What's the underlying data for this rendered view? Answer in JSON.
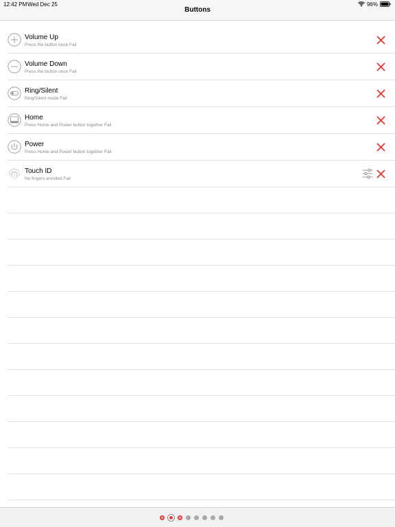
{
  "status_bar": {
    "time": "12:42 PM",
    "date": "Wed Dec 25",
    "battery": "96%"
  },
  "nav": {
    "title": "Buttons"
  },
  "items": [
    {
      "title": "Volume Up",
      "subtitle": "Press the button once Fail",
      "icon": "plus-circle-icon",
      "status": "fail"
    },
    {
      "title": "Volume Down",
      "subtitle": "Press the button once Fail",
      "icon": "minus-circle-icon",
      "status": "fail"
    },
    {
      "title": "Ring/Silent",
      "subtitle": "Ring/Silent mode Fail",
      "icon": "toggle-switch-icon",
      "status": "fail"
    },
    {
      "title": "Home",
      "subtitle": "Press Home and Power button together Fail",
      "icon": "home-button-icon",
      "status": "fail"
    },
    {
      "title": "Power",
      "subtitle": "Press Home and Power button together Fail",
      "icon": "power-icon",
      "status": "fail"
    },
    {
      "title": "Touch ID",
      "subtitle": "No fingers enrolled Fail",
      "icon": "fingerprint-icon",
      "status": "fail",
      "settings_icon": "sliders-icon"
    }
  ],
  "pager": {
    "dots": [
      "fail",
      "current-fail",
      "fail",
      "pending",
      "pending",
      "pending",
      "pending",
      "pending"
    ]
  },
  "colors": {
    "fail": "#e53935",
    "pending": "#a8a8a8",
    "icon_gray": "#8e8e8e"
  }
}
